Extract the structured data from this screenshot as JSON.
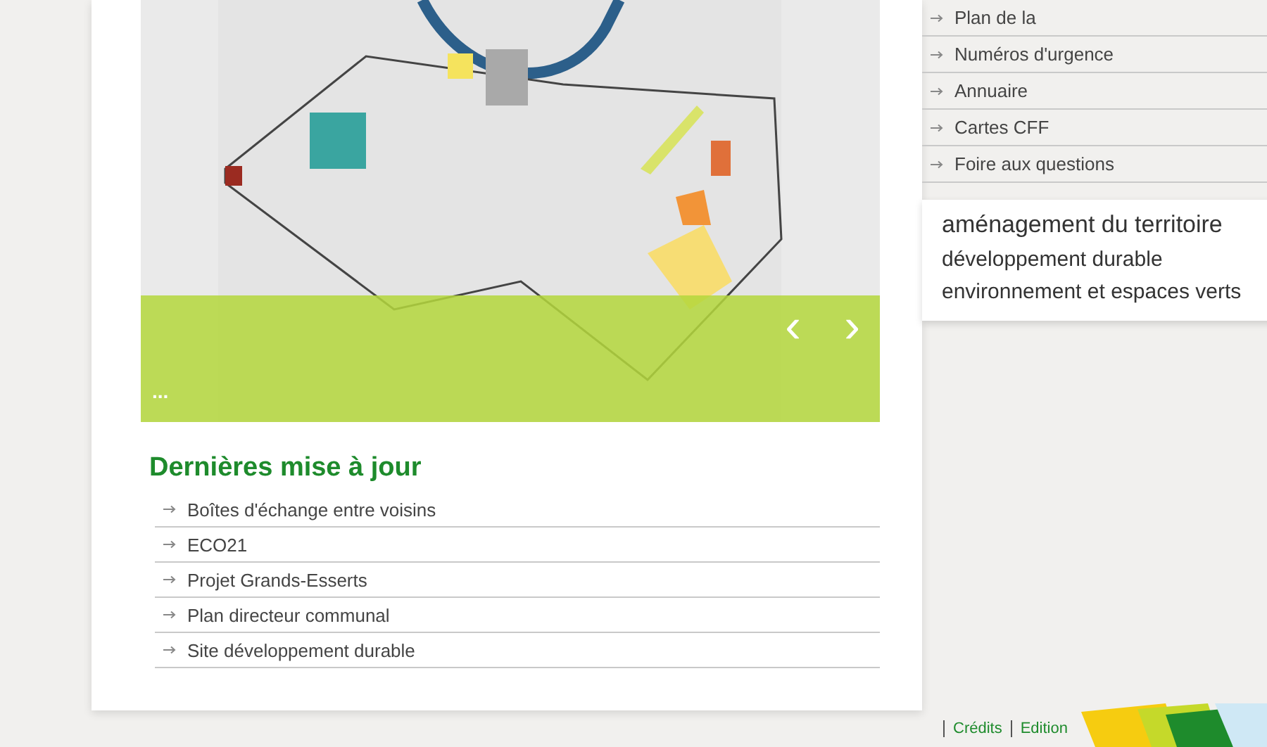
{
  "map_slider": {
    "caption": "...",
    "prev_label": "‹",
    "next_label": "›"
  },
  "updates": {
    "title": "Dernières mise à jour",
    "items": [
      {
        "label": "Boîtes d'échange entre voisins"
      },
      {
        "label": "ECO21"
      },
      {
        "label": "Projet Grands-Esserts"
      },
      {
        "label": "Plan directeur communal"
      },
      {
        "label": "Site développement durable"
      }
    ]
  },
  "side_menu": {
    "items": [
      {
        "label": "Plan de la"
      },
      {
        "label": "Numéros d'urgence"
      },
      {
        "label": "Annuaire"
      },
      {
        "label": "Cartes CFF"
      },
      {
        "label": "Foire aux questions"
      }
    ]
  },
  "tags": [
    {
      "label": "aménagement du territoire",
      "kind": "large"
    },
    {
      "label": "développement durable",
      "kind": "medium"
    },
    {
      "label": "environnement et espaces verts",
      "kind": "medium"
    }
  ],
  "footer": {
    "links": [
      {
        "label": "Crédits"
      },
      {
        "label": "Edition"
      }
    ]
  }
}
